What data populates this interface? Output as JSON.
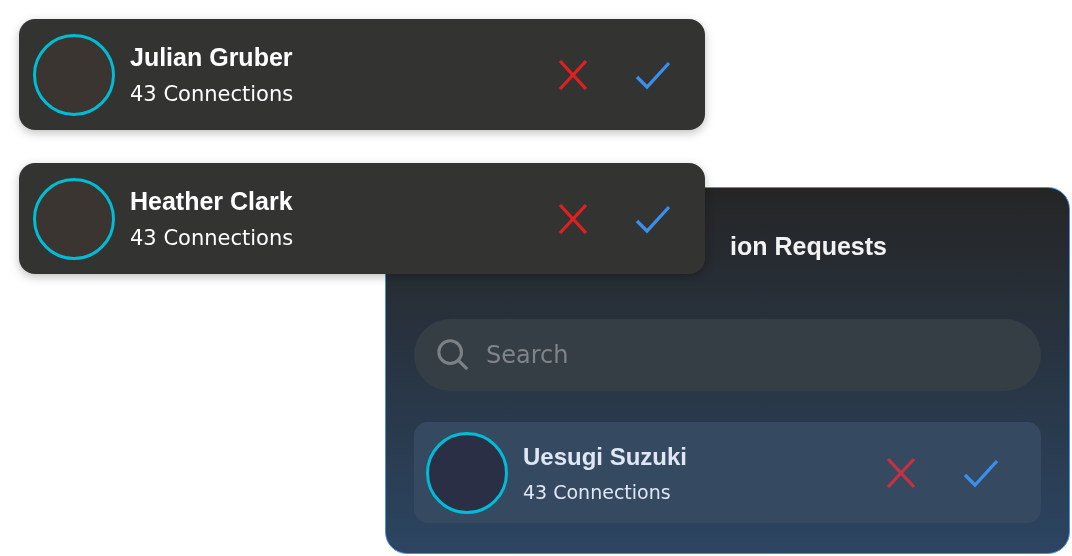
{
  "floating_requests": [
    {
      "name": "Julian Gruber",
      "connections": "43 Connections"
    },
    {
      "name": "Heather Clark",
      "connections": "43 Connections"
    }
  ],
  "panel": {
    "title": "ion Requests",
    "search": {
      "placeholder": "Search"
    },
    "requests": [
      {
        "name": "Uesugi Suzuki",
        "connections": "43 Connections"
      }
    ]
  }
}
